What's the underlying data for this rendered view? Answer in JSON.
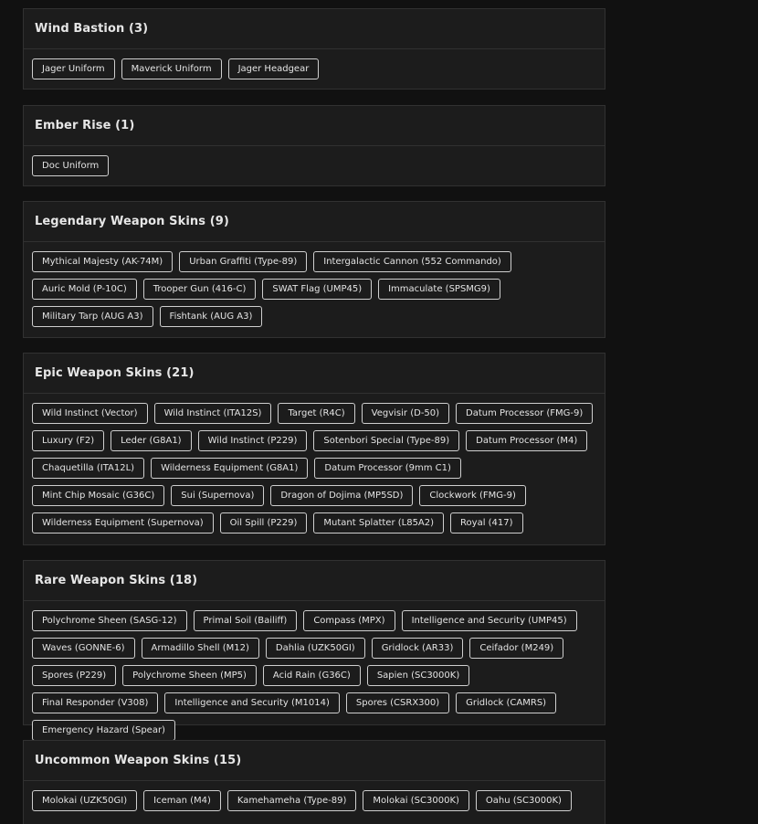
{
  "sections": [
    {
      "title": "Wind Bastion (3)",
      "items": [
        "Jager Uniform",
        "Maverick Uniform",
        "Jager Headgear"
      ]
    },
    {
      "title": "Ember Rise (1)",
      "items": [
        "Doc Uniform"
      ]
    },
    {
      "title": "Legendary Weapon Skins (9)",
      "items": [
        "Mythical Majesty (AK-74M)",
        "Urban Graffiti (Type-89)",
        "Intergalactic Cannon (552 Commando)",
        "Auric Mold (P-10C)",
        "Trooper Gun (416-C)",
        "SWAT Flag (UMP45)",
        "Immaculate (SPSMG9)",
        "Military Tarp (AUG A3)",
        "Fishtank (AUG A3)"
      ]
    },
    {
      "title": "Epic Weapon Skins (21)",
      "items": [
        "Wild Instinct (Vector)",
        "Wild Instinct (ITA12S)",
        "Target (R4C)",
        "Vegvisir (D-50)",
        "Datum Processor (FMG-9)",
        "Luxury (F2)",
        "Leder (G8A1)",
        "Wild Instinct (P229)",
        "Sotenbori Special (Type-89)",
        "Datum Processor (M4)",
        "Chaquetilla (ITA12L)",
        "Wilderness Equipment (G8A1)",
        "Datum Processor (9mm C1)",
        "Mint Chip Mosaic (G36C)",
        "Sui (Supernova)",
        "Dragon of Dojima (MP5SD)",
        "Clockwork (FMG-9)",
        "Wilderness Equipment (Supernova)",
        "Oil Spill (P229)",
        "Mutant Splatter (L85A2)",
        "Royal (417)"
      ]
    },
    {
      "title": "Rare Weapon Skins (18)",
      "items": [
        "Polychrome Sheen (SASG-12)",
        "Primal Soil (Bailiff)",
        "Compass (MPX)",
        "Intelligence and Security (UMP45)",
        "Waves (GONNE-6)",
        "Armadillo Shell (M12)",
        "Dahlia (UZK50GI)",
        "Gridlock (AR33)",
        "Ceifador (M249)",
        "Spores (P229)",
        "Polychrome Sheen (MP5)",
        "Acid Rain (G36C)",
        "Sapien (SC3000K)",
        "Final Responder (V308)",
        "Intelligence and Security (M1014)",
        "Spores (CSRX300)",
        "Gridlock (CAMRS)",
        "Emergency Hazard (Spear)"
      ]
    },
    {
      "title": "Uncommon Weapon Skins (15)",
      "items": [
        "Molokai (UZK50GI)",
        "Iceman (M4)",
        "Kamehameha (Type-89)",
        "Molokai (SC3000K)",
        "Oahu (SC3000K)"
      ]
    }
  ]
}
